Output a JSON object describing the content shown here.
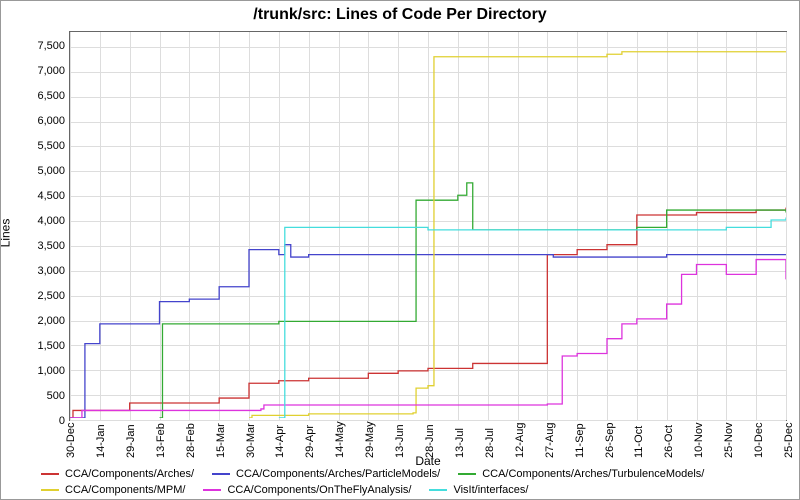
{
  "chart_data": {
    "type": "line",
    "title": "/trunk/src: Lines of Code Per Directory",
    "xlabel": "Date",
    "ylabel": "Lines",
    "ylim": [
      0,
      7800
    ],
    "yticks": [
      0,
      500,
      1000,
      1500,
      2000,
      2500,
      3000,
      3500,
      4000,
      4500,
      5000,
      5500,
      6000,
      6500,
      7000,
      7500
    ],
    "yticklabels": [
      "0",
      "500",
      "1,000",
      "1,500",
      "2,000",
      "2,500",
      "3,000",
      "3,500",
      "4,000",
      "4,500",
      "5,000",
      "5,500",
      "6,000",
      "6,500",
      "7,000",
      "7,500"
    ],
    "xticks": [
      "30-Dec",
      "14-Jan",
      "29-Jan",
      "13-Feb",
      "28-Feb",
      "15-Mar",
      "30-Mar",
      "14-Apr",
      "29-Apr",
      "14-May",
      "29-May",
      "13-Jun",
      "28-Jun",
      "13-Jul",
      "28-Jul",
      "12-Aug",
      "27-Aug",
      "11-Sep",
      "26-Sep",
      "11-Oct",
      "26-Oct",
      "10-Nov",
      "25-Nov",
      "10-Dec",
      "25-Dec"
    ],
    "series": [
      {
        "name": "CCA/Components/Arches/",
        "color": "#cc3333",
        "points": [
          [
            0,
            0
          ],
          [
            0.1,
            150
          ],
          [
            2,
            300
          ],
          [
            3,
            300
          ],
          [
            5,
            400
          ],
          [
            6,
            700
          ],
          [
            7,
            750
          ],
          [
            8,
            800
          ],
          [
            10,
            900
          ],
          [
            11,
            950
          ],
          [
            12,
            1000
          ],
          [
            13.3,
            1000
          ],
          [
            13.5,
            1100
          ],
          [
            15,
            1100
          ],
          [
            16,
            3300
          ],
          [
            17,
            3400
          ],
          [
            18,
            3500
          ],
          [
            19,
            4100
          ],
          [
            20,
            4100
          ],
          [
            21,
            4150
          ],
          [
            23,
            4200
          ],
          [
            24,
            4250
          ]
        ]
      },
      {
        "name": "CCA/Components/Arches/ParticleModels/",
        "color": "#4444cc",
        "points": [
          [
            0,
            0
          ],
          [
            0.5,
            1500
          ],
          [
            1,
            1900
          ],
          [
            3,
            2350
          ],
          [
            4,
            2400
          ],
          [
            5,
            2650
          ],
          [
            6,
            3400
          ],
          [
            7,
            3300
          ],
          [
            7.2,
            3500
          ],
          [
            7.4,
            3250
          ],
          [
            8,
            3300
          ],
          [
            16,
            3300
          ],
          [
            16.2,
            3250
          ],
          [
            20,
            3300
          ],
          [
            22,
            3300
          ],
          [
            24,
            3300
          ]
        ]
      },
      {
        "name": "CCA/Components/Arches/TurbulenceModels/",
        "color": "#33aa33",
        "points": [
          [
            3,
            0
          ],
          [
            3.1,
            1900
          ],
          [
            7,
            1950
          ],
          [
            11.5,
            1950
          ],
          [
            11.6,
            4400
          ],
          [
            13,
            4500
          ],
          [
            13.3,
            4750
          ],
          [
            13.5,
            3800
          ],
          [
            18,
            3800
          ],
          [
            19,
            3850
          ],
          [
            20,
            4200
          ],
          [
            22,
            4200
          ],
          [
            24,
            4150
          ]
        ]
      },
      {
        "name": "CCA/Components/MPM/",
        "color": "#e0d030",
        "points": [
          [
            6,
            0
          ],
          [
            6.1,
            50
          ],
          [
            8,
            80
          ],
          [
            11.5,
            100
          ],
          [
            11.6,
            600
          ],
          [
            12,
            650
          ],
          [
            12.2,
            7300
          ],
          [
            18,
            7350
          ],
          [
            18.5,
            7400
          ],
          [
            24,
            7400
          ]
        ]
      },
      {
        "name": "CCA/Components/OnTheFlyAnalysis/",
        "color": "#dd33dd",
        "points": [
          [
            0,
            0
          ],
          [
            0.4,
            150
          ],
          [
            6.4,
            180
          ],
          [
            6.5,
            260
          ],
          [
            16,
            280
          ],
          [
            16.5,
            1250
          ],
          [
            17,
            1300
          ],
          [
            18,
            1600
          ],
          [
            18.5,
            1900
          ],
          [
            19,
            2000
          ],
          [
            20,
            2300
          ],
          [
            20.5,
            2900
          ],
          [
            21,
            3100
          ],
          [
            22,
            2900
          ],
          [
            23,
            3200
          ],
          [
            23.5,
            3200
          ],
          [
            24,
            2800
          ]
        ]
      },
      {
        "name": "VisIt/interfaces/",
        "color": "#44dddd",
        "points": [
          [
            7,
            0
          ],
          [
            7.2,
            3850
          ],
          [
            12,
            3800
          ],
          [
            20,
            3800
          ],
          [
            22,
            3850
          ],
          [
            23,
            3850
          ],
          [
            23.5,
            4000
          ],
          [
            24,
            4050
          ]
        ]
      }
    ]
  }
}
